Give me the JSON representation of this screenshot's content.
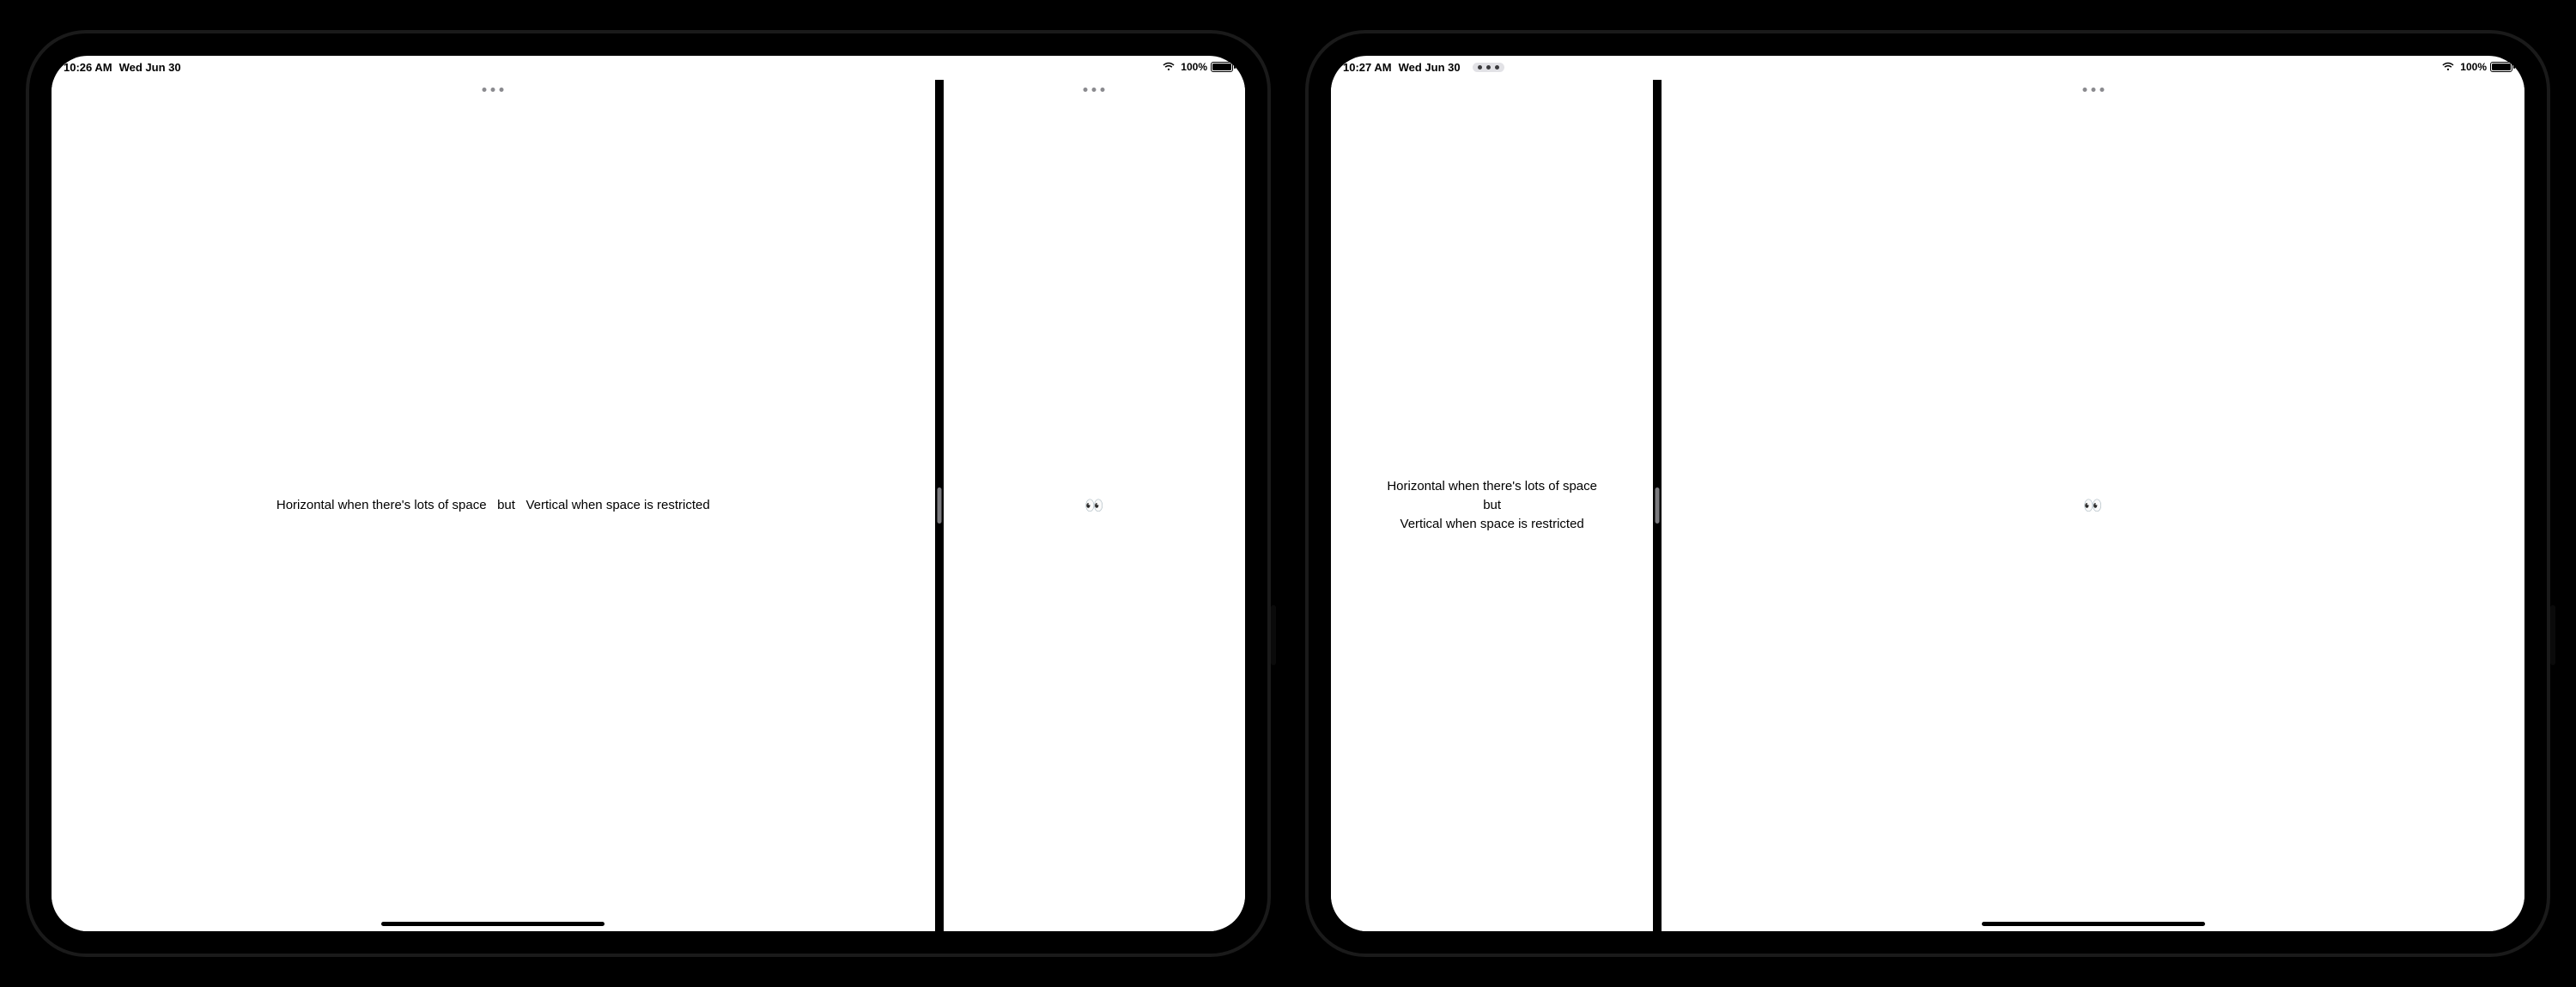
{
  "devices": [
    {
      "status": {
        "time": "10:26 AM",
        "date": "Wed Jun 30",
        "battery_pct": "100%"
      },
      "left_pane": {
        "orientation": "horizontal",
        "line1": "Horizontal when there's lots of space",
        "line2": "but",
        "line3": "Vertical when space is restricted"
      },
      "right_pane": {
        "emoji": "👀"
      },
      "left_dots_active": false,
      "right_dots_active": false
    },
    {
      "status": {
        "time": "10:27 AM",
        "date": "Wed Jun 30",
        "battery_pct": "100%"
      },
      "left_pane": {
        "orientation": "vertical",
        "line1": "Horizontal when there's lots of space",
        "line2": "but",
        "line3": "Vertical when space is restricted"
      },
      "right_pane": {
        "emoji": "👀"
      },
      "left_dots_active": true,
      "right_dots_active": false
    }
  ],
  "icons": {
    "multitask": "multitask-dots-icon",
    "wifi": "wifi-icon",
    "battery": "battery-icon"
  }
}
